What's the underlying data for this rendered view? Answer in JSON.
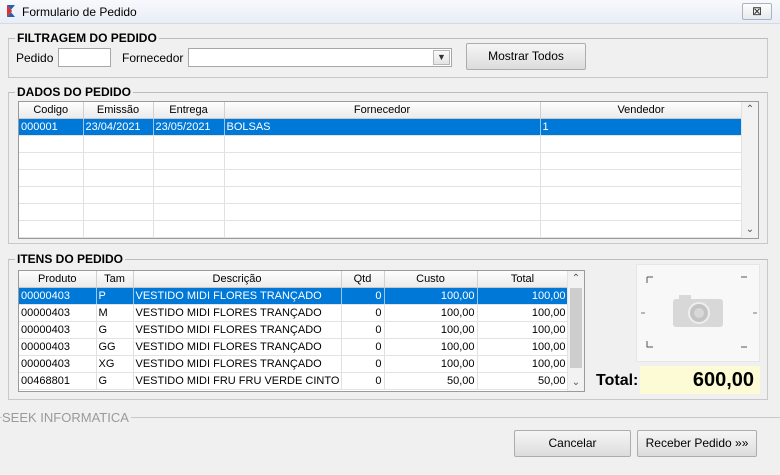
{
  "window": {
    "title": "Formulario de Pedido",
    "close_glyph": "⊠"
  },
  "filter": {
    "label": "FILTRAGEM DO PEDIDO",
    "pedido_label": "Pedido",
    "pedido_value": "",
    "fornecedor_label": "Fornecedor",
    "fornecedor_value": "",
    "show_all_label": "Mostrar Todos"
  },
  "orders": {
    "label": "DADOS DO PEDIDO",
    "columns": [
      "Codigo",
      "Emissão",
      "Entrega",
      "Fornecedor",
      "Vendedor"
    ],
    "rows": [
      [
        "000001",
        "23/04/2021",
        "23/05/2021",
        "BOLSAS",
        "1"
      ]
    ]
  },
  "items": {
    "label": "ITENS DO PEDIDO",
    "columns": [
      "Produto",
      "Tam",
      "Descrição",
      "Qtd",
      "Custo",
      "Total"
    ],
    "rows": [
      [
        "00000403",
        "P",
        "VESTIDO MIDI FLORES TRANÇADO",
        "0",
        "100,00",
        "100,00"
      ],
      [
        "00000403",
        "M",
        "VESTIDO MIDI FLORES TRANÇADO",
        "0",
        "100,00",
        "100,00"
      ],
      [
        "00000403",
        "G",
        "VESTIDO MIDI FLORES TRANÇADO",
        "0",
        "100,00",
        "100,00"
      ],
      [
        "00000403",
        "GG",
        "VESTIDO MIDI FLORES TRANÇADO",
        "0",
        "100,00",
        "100,00"
      ],
      [
        "00000403",
        "XG",
        "VESTIDO MIDI FLORES TRANÇADO",
        "0",
        "100,00",
        "100,00"
      ],
      [
        "00468801",
        "G",
        "VESTIDO MIDI FRU FRU VERDE CINTO OF",
        "0",
        "50,00",
        "50,00"
      ]
    ]
  },
  "total": {
    "label": "Total:",
    "value": "600,00"
  },
  "footer": {
    "brand": "SEEK INFORMATICA",
    "cancel_label": "Cancelar",
    "receive_label": "Receber Pedido »»"
  },
  "colors": {
    "selection": "#0078d7",
    "total_bg": "#fdfbd6"
  }
}
